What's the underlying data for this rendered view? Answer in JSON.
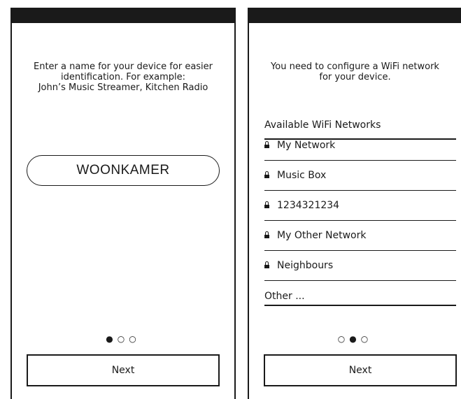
{
  "screen_1": {
    "instruction_lines": [
      "Enter a name for your device for easier",
      "identification. For example:",
      "John’s Music Streamer, Kitchen Radio"
    ],
    "device_name_value": "WOONKAMER",
    "page_dots": [
      "●",
      "○",
      "○"
    ],
    "next_label": "Next"
  },
  "screen_2": {
    "instruction_lines": [
      "You need to configure a WiFi network",
      "for your device."
    ],
    "networks_heading": "Available WiFi Networks",
    "networks": [
      {
        "name": "My Network",
        "icon": "lock-icon"
      },
      {
        "name": "Music Box",
        "icon": "lock-icon"
      },
      {
        "name": "1234321234",
        "icon": "lock-icon"
      },
      {
        "name": "My Other Network",
        "icon": "lock-icon"
      },
      {
        "name": "Neighbours",
        "icon": "lock-icon"
      },
      {
        "name": "Other ...",
        "icon": ""
      }
    ],
    "page_dots": [
      "○",
      "●",
      "○"
    ],
    "next_label": "Next"
  },
  "colors": {
    "ink": "#1a1a1a",
    "background": "#ffffff"
  }
}
